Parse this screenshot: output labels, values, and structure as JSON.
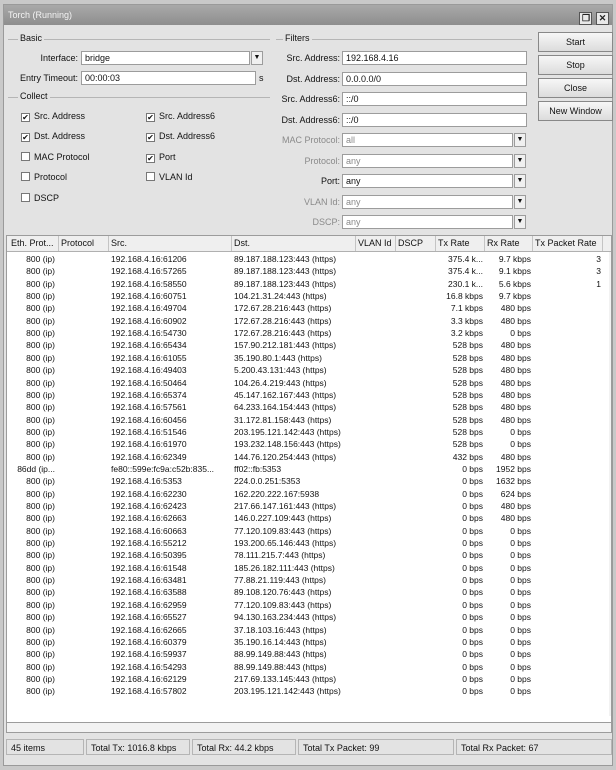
{
  "window": {
    "title": "Torch (Running)",
    "minimize": "❐",
    "close": "✕"
  },
  "basic": {
    "group": "Basic",
    "interface_label": "Interface:",
    "interface_value": "bridge",
    "entry_timeout_label": "Entry Timeout:",
    "entry_timeout_value": "00:00:03",
    "unit": "s"
  },
  "collect": {
    "group": "Collect",
    "items": [
      {
        "label": "Src. Address",
        "checked": true
      },
      {
        "label": "Dst. Address",
        "checked": true
      },
      {
        "label": "MAC Protocol",
        "checked": false
      },
      {
        "label": "Protocol",
        "checked": false
      },
      {
        "label": "DSCP",
        "checked": false
      },
      {
        "label": "Src. Address6",
        "checked": true
      },
      {
        "label": "Dst. Address6",
        "checked": true
      },
      {
        "label": "Port",
        "checked": true
      },
      {
        "label": "VLAN Id",
        "checked": false
      }
    ]
  },
  "filters": {
    "group": "Filters",
    "fields": [
      {
        "label": "Src. Address:",
        "value": "192.168.4.16",
        "dim": false,
        "dropdown": false
      },
      {
        "label": "Dst. Address:",
        "value": "0.0.0.0/0",
        "dim": false,
        "dropdown": false
      },
      {
        "label": "Src. Address6:",
        "value": "::/0",
        "dim": false,
        "dropdown": false
      },
      {
        "label": "Dst. Address6:",
        "value": "::/0",
        "dim": false,
        "dropdown": false
      },
      {
        "label": "MAC Protocol:",
        "value": "all",
        "dim": true,
        "dropdown": true
      },
      {
        "label": "Protocol:",
        "value": "any",
        "dim": true,
        "dropdown": true
      },
      {
        "label": "Port:",
        "value": "any",
        "dim": false,
        "dropdown": true
      },
      {
        "label": "VLAN Id:",
        "value": "any",
        "dim": true,
        "dropdown": true
      },
      {
        "label": "DSCP:",
        "value": "any",
        "dim": true,
        "dropdown": true
      }
    ]
  },
  "buttons": {
    "start": "Start",
    "stop": "Stop",
    "close": "Close",
    "new_window": "New Window"
  },
  "table": {
    "headers": [
      "Eth. Prot...",
      "Protocol",
      "Src.",
      "Dst.",
      "VLAN Id",
      "DSCP",
      "Tx Rate",
      "Rx Rate",
      "Tx Packet Rate"
    ],
    "rows": [
      [
        "800 (ip)",
        "",
        "192.168.4.16:61206",
        "89.187.188.123:443 (https)",
        "",
        "",
        "375.4 k...",
        "9.7 kbps",
        "3"
      ],
      [
        "800 (ip)",
        "",
        "192.168.4.16:57265",
        "89.187.188.123:443 (https)",
        "",
        "",
        "375.4 k...",
        "9.1 kbps",
        "3"
      ],
      [
        "800 (ip)",
        "",
        "192.168.4.16:58550",
        "89.187.188.123:443 (https)",
        "",
        "",
        "230.1 k...",
        "5.6 kbps",
        "1"
      ],
      [
        "800 (ip)",
        "",
        "192.168.4.16:60751",
        "104.21.31.24:443 (https)",
        "",
        "",
        "16.8 kbps",
        "9.7 kbps",
        ""
      ],
      [
        "800 (ip)",
        "",
        "192.168.4.16:49704",
        "172.67.28.216:443 (https)",
        "",
        "",
        "7.1 kbps",
        "480 bps",
        ""
      ],
      [
        "800 (ip)",
        "",
        "192.168.4.16:60902",
        "172.67.28.216:443 (https)",
        "",
        "",
        "3.3 kbps",
        "480 bps",
        ""
      ],
      [
        "800 (ip)",
        "",
        "192.168.4.16:54730",
        "172.67.28.216:443 (https)",
        "",
        "",
        "3.2 kbps",
        "0 bps",
        ""
      ],
      [
        "800 (ip)",
        "",
        "192.168.4.16:65434",
        "157.90.212.181:443 (https)",
        "",
        "",
        "528 bps",
        "480 bps",
        ""
      ],
      [
        "800 (ip)",
        "",
        "192.168.4.16:61055",
        "35.190.80.1:443 (https)",
        "",
        "",
        "528 bps",
        "480 bps",
        ""
      ],
      [
        "800 (ip)",
        "",
        "192.168.4.16:49403",
        "5.200.43.131:443 (https)",
        "",
        "",
        "528 bps",
        "480 bps",
        ""
      ],
      [
        "800 (ip)",
        "",
        "192.168.4.16:50464",
        "104.26.4.219:443 (https)",
        "",
        "",
        "528 bps",
        "480 bps",
        ""
      ],
      [
        "800 (ip)",
        "",
        "192.168.4.16:65374",
        "45.147.162.167:443 (https)",
        "",
        "",
        "528 bps",
        "480 bps",
        ""
      ],
      [
        "800 (ip)",
        "",
        "192.168.4.16:57561",
        "64.233.164.154:443 (https)",
        "",
        "",
        "528 bps",
        "480 bps",
        ""
      ],
      [
        "800 (ip)",
        "",
        "192.168.4.16:60456",
        "31.172.81.158:443 (https)",
        "",
        "",
        "528 bps",
        "480 bps",
        ""
      ],
      [
        "800 (ip)",
        "",
        "192.168.4.16:51546",
        "203.195.121.142:443 (https)",
        "",
        "",
        "528 bps",
        "0 bps",
        ""
      ],
      [
        "800 (ip)",
        "",
        "192.168.4.16:61970",
        "193.232.148.156:443 (https)",
        "",
        "",
        "528 bps",
        "0 bps",
        ""
      ],
      [
        "800 (ip)",
        "",
        "192.168.4.16:62349",
        "144.76.120.254:443 (https)",
        "",
        "",
        "432 bps",
        "480 bps",
        ""
      ],
      [
        "86dd (ip...",
        "",
        "fe80::599e:fc9a:c52b:835...",
        "ff02::fb:5353",
        "",
        "",
        "0 bps",
        "1952 bps",
        ""
      ],
      [
        "800 (ip)",
        "",
        "192.168.4.16:5353",
        "224.0.0.251:5353",
        "",
        "",
        "0 bps",
        "1632 bps",
        ""
      ],
      [
        "800 (ip)",
        "",
        "192.168.4.16:62230",
        "162.220.222.167:5938",
        "",
        "",
        "0 bps",
        "624 bps",
        ""
      ],
      [
        "800 (ip)",
        "",
        "192.168.4.16:62423",
        "217.66.147.161:443 (https)",
        "",
        "",
        "0 bps",
        "480 bps",
        ""
      ],
      [
        "800 (ip)",
        "",
        "192.168.4.16:62663",
        "146.0.227.109:443 (https)",
        "",
        "",
        "0 bps",
        "480 bps",
        ""
      ],
      [
        "800 (ip)",
        "",
        "192.168.4.16:60663",
        "77.120.109.83:443 (https)",
        "",
        "",
        "0 bps",
        "0 bps",
        ""
      ],
      [
        "800 (ip)",
        "",
        "192.168.4.16:55212",
        "193.200.65.146:443 (https)",
        "",
        "",
        "0 bps",
        "0 bps",
        ""
      ],
      [
        "800 (ip)",
        "",
        "192.168.4.16:50395",
        "78.111.215.7:443 (https)",
        "",
        "",
        "0 bps",
        "0 bps",
        ""
      ],
      [
        "800 (ip)",
        "",
        "192.168.4.16:61548",
        "185.26.182.111:443 (https)",
        "",
        "",
        "0 bps",
        "0 bps",
        ""
      ],
      [
        "800 (ip)",
        "",
        "192.168.4.16:63481",
        "77.88.21.119:443 (https)",
        "",
        "",
        "0 bps",
        "0 bps",
        ""
      ],
      [
        "800 (ip)",
        "",
        "192.168.4.16:63588",
        "89.108.120.76:443 (https)",
        "",
        "",
        "0 bps",
        "0 bps",
        ""
      ],
      [
        "800 (ip)",
        "",
        "192.168.4.16:62959",
        "77.120.109.83:443 (https)",
        "",
        "",
        "0 bps",
        "0 bps",
        ""
      ],
      [
        "800 (ip)",
        "",
        "192.168.4.16:65527",
        "94.130.163.234:443 (https)",
        "",
        "",
        "0 bps",
        "0 bps",
        ""
      ],
      [
        "800 (ip)",
        "",
        "192.168.4.16:62665",
        "37.18.103.16:443 (https)",
        "",
        "",
        "0 bps",
        "0 bps",
        ""
      ],
      [
        "800 (ip)",
        "",
        "192.168.4.16:60379",
        "35.190.16.14:443 (https)",
        "",
        "",
        "0 bps",
        "0 bps",
        ""
      ],
      [
        "800 (ip)",
        "",
        "192.168.4.16:59937",
        "88.99.149.88:443 (https)",
        "",
        "",
        "0 bps",
        "0 bps",
        ""
      ],
      [
        "800 (ip)",
        "",
        "192.168.4.16:54293",
        "88.99.149.88:443 (https)",
        "",
        "",
        "0 bps",
        "0 bps",
        ""
      ],
      [
        "800 (ip)",
        "",
        "192.168.4.16:62129",
        "217.69.133.145:443 (https)",
        "",
        "",
        "0 bps",
        "0 bps",
        ""
      ],
      [
        "800 (ip)",
        "",
        "192.168.4.16:57802",
        "203.195.121.142:443 (https)",
        "",
        "",
        "0 bps",
        "0 bps",
        ""
      ]
    ]
  },
  "status": {
    "items": "45 items",
    "total_tx": "Total Tx: 1016.8 kbps",
    "total_rx": "Total Rx: 44.2 kbps",
    "total_tx_packet": "Total Tx Packet: 99",
    "total_rx_packet": "Total Rx Packet: 67"
  }
}
